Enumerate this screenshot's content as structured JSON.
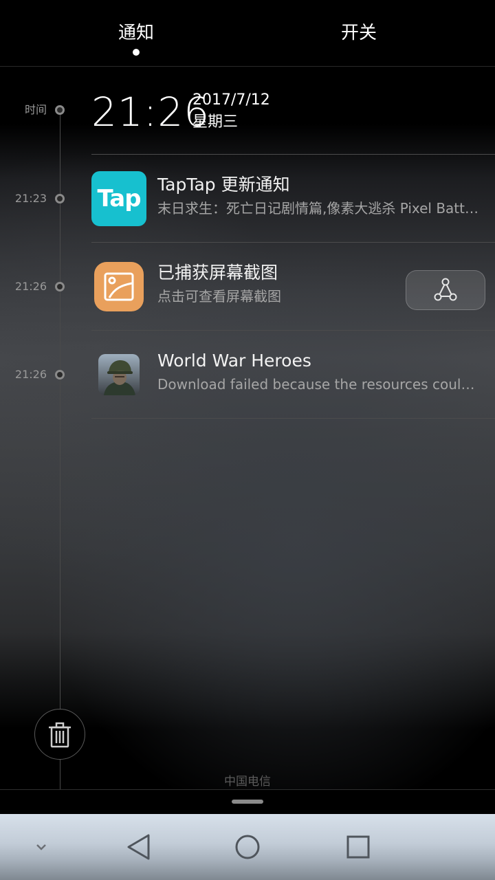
{
  "tabs": {
    "notifications": "通知",
    "toggles": "开关"
  },
  "header": {
    "timeline_label": "时间",
    "clock": "21:26",
    "date": "2017/7/12",
    "weekday": "星期三"
  },
  "notifications": [
    {
      "time": "21:23",
      "app_icon": "taptap-app-icon",
      "icon_text": "Tap",
      "title": "TapTap 更新通知",
      "text": "末日求生：死亡日记剧情篇,像素大逃杀 Pixel Battle Royale"
    },
    {
      "time": "21:26",
      "app_icon": "screenshot-app-icon",
      "title": "已捕获屏幕截图",
      "text": "点击可查看屏幕截图",
      "action_icon": "share-icon"
    },
    {
      "time": "21:26",
      "app_icon": "world-war-heroes-icon",
      "title": "World War Heroes",
      "text": "Download failed because the resources could not be found"
    }
  ],
  "footer": {
    "carrier": "中国电信"
  },
  "icons": {
    "trash": "trash-icon",
    "nav_collapse": "chevron-down-icon",
    "nav_back": "back-triangle-icon",
    "nav_home": "home-circle-icon",
    "nav_recents": "recents-square-icon"
  },
  "colors": {
    "taptap": "#17c0cf",
    "screenshot_icon": "#e9a05c"
  }
}
